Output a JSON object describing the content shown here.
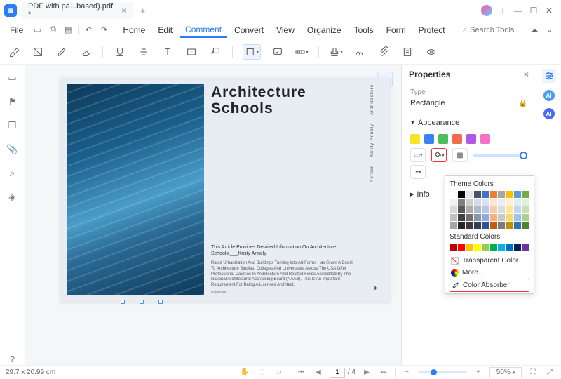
{
  "titlebar": {
    "tab_label": "PDF with pa...based).pdf *"
  },
  "menubar": {
    "file": "File",
    "items": [
      "Home",
      "Edit",
      "Comment",
      "Convert",
      "View",
      "Organize",
      "Tools",
      "Form",
      "Protect"
    ],
    "active_index": 2,
    "search_placeholder": "Search Tools"
  },
  "toolbar": {
    "icons": [
      "highlighter",
      "area-highlight",
      "pencil",
      "eraser",
      "underline",
      "strikethrough",
      "text",
      "textbox",
      "callout",
      "shape",
      "note",
      "distance",
      "sep",
      "stamp",
      "signature",
      "attachment",
      "note-list",
      "show-comments"
    ]
  },
  "leftbar": {
    "icons": [
      "page",
      "bookmark",
      "thumbnail",
      "attachment",
      "search",
      "layers"
    ],
    "bottom": "help"
  },
  "page": {
    "title_l1": "Architecture",
    "title_l2": "Schools",
    "side_labels": [
      "Architecture",
      "Kristy Annely",
      "Author"
    ],
    "sub": "This Article Provides Detailed Information On Architecture Schools.___Kristy Annely",
    "body": "Rapid Urbanization And Buildings Turning Into Art Forms Has Given A Boost To Architecture Studies. Colleges And Universities Across The USA Offer Professional Courses In Architecture And Related Fields Accredited By The National Architectural Accrediting Board (NAAB). This Is An Important Requirement For Being A Licensed Architect.",
    "footer": "Page5of8"
  },
  "rightpanel": {
    "title": "Properties",
    "type_label": "Type",
    "type_value": "Rectangle",
    "appearance_label": "Appearance",
    "swatches": [
      "#f5e52a",
      "#3d82f5",
      "#4bbf5e",
      "#f26b4e",
      "#b057e8",
      "#f571c6"
    ],
    "info_label": "Info"
  },
  "colorpop": {
    "theme_title": "Theme Colors",
    "theme_colors": [
      [
        "#ffffff",
        "#000000",
        "#e7e6e6",
        "#44546a",
        "#4472c4",
        "#ed7d31",
        "#a5a5a5",
        "#ffc000",
        "#5b9bd5",
        "#70ad47"
      ],
      [
        "#f2f2f2",
        "#7f7f7f",
        "#d0cece",
        "#d6dce5",
        "#d9e2f3",
        "#fbe5d6",
        "#ededed",
        "#fff2cc",
        "#deebf7",
        "#e2f0d9"
      ],
      [
        "#d9d9d9",
        "#595959",
        "#aeabab",
        "#adb9ca",
        "#b4c7e7",
        "#f7cbac",
        "#dbdbdb",
        "#ffe699",
        "#bdd7ee",
        "#c5e0b4"
      ],
      [
        "#bfbfbf",
        "#3f3f3f",
        "#757070",
        "#8497b0",
        "#8faadc",
        "#f4b183",
        "#c9c9c9",
        "#ffd966",
        "#9dc3e6",
        "#a9d18e"
      ],
      [
        "#a6a6a6",
        "#262626",
        "#3a3838",
        "#333f50",
        "#2f5597",
        "#c55a11",
        "#7b7b7b",
        "#bf9000",
        "#2e75b6",
        "#548235"
      ]
    ],
    "std_title": "Standard Colors",
    "std_colors": [
      "#c00000",
      "#ff0000",
      "#ffc000",
      "#ffff00",
      "#92d050",
      "#00b050",
      "#00b0f0",
      "#0070c0",
      "#002060",
      "#7030a0"
    ],
    "transparent": "Transparent Color",
    "more": "More...",
    "absorber": "Color Absorber"
  },
  "statusbar": {
    "dims": "29.7 x 20.99 cm",
    "page_current": "1",
    "page_total": "/ 4",
    "zoom": "50%"
  }
}
